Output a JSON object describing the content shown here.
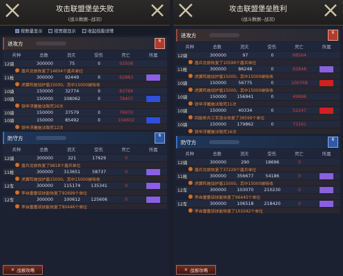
{
  "left": {
    "title": "攻击联盟堡垒失败",
    "subtitle": "(战斗数据--战况)",
    "options": [
      {
        "label": "按数量显示",
        "checked": true
      },
      {
        "label": "按贡献显示",
        "checked": false
      },
      {
        "label": "收起技能详情",
        "checked": false
      }
    ],
    "attack": {
      "label": "进攻方",
      "badge": "后防\n6",
      "color": "#b33a2f"
    },
    "defense": {
      "label": "防守方",
      "badge": "后防\n6",
      "color": "#2f58a6"
    },
    "headers": [
      "兵种",
      "总数",
      "消灭",
      "受伤",
      "死亡",
      "所属"
    ],
    "attack_rows": [
      {
        "unit": "12骑",
        "total": "300000",
        "kill": "75",
        "hurt": "0",
        "dead": "93508",
        "note": "盾兵龙旅恢复了14604个盾兵单位",
        "nk": ""
      },
      {
        "unit": "11枪",
        "total": "300000",
        "kill": "92449",
        "hurt": "0",
        "dead": "62883",
        "note": "虎翼阵施加护盾15000。其中15000被吸收",
        "nk": ""
      },
      {
        "unit": "10骑",
        "total": "150000",
        "kill": "32774",
        "hurt": "0",
        "dead": "83784",
        "note": "",
        "nk": ""
      },
      {
        "unit": "10骑",
        "total": "150000",
        "kill": "108062",
        "hurt": "0",
        "dead": "78407",
        "note": "铁甲浮屠施法致死16次",
        "nk": ""
      },
      {
        "unit": "10骑",
        "total": "150000",
        "kill": "37579",
        "hurt": "0",
        "dead": "76970",
        "note": "",
        "nk": ""
      },
      {
        "unit": "10骑",
        "total": "150000",
        "kill": "85492",
        "hurt": "0",
        "dead": "104602",
        "note": "铁甲浮屠施法致死12次",
        "nk": ""
      }
    ],
    "defense_rows": [
      {
        "unit": "12骑",
        "total": "300000",
        "kill": "321",
        "hurt": "17929",
        "dead": "0",
        "note": "盾兵龙旅恢复了9818个盾兵单位"
      },
      {
        "unit": "11枪",
        "total": "300000",
        "kill": "313651",
        "hurt": "58737",
        "dead": "0",
        "note": "虎翼阵施加护盾15000。其中15000被吸收"
      },
      {
        "unit": "12车",
        "total": "300000",
        "kill": "115174",
        "hurt": "135341",
        "dead": "0",
        "note": "李自雷雷该技能恢复了92699个单位"
      },
      {
        "unit": "12车",
        "total": "300000",
        "kill": "100612",
        "hurt": "125606",
        "dead": "0",
        "note": "李自雷雷该技能恢复了80446个单位"
      }
    ],
    "footer": "战报攻略"
  },
  "right": {
    "title": "攻击联盟堡垒胜利",
    "subtitle": "(战斗数据--战况)",
    "attack": {
      "label": "进攻方",
      "badge": "后防\n6"
    },
    "defense": {
      "label": "防守方",
      "badge": "后防\n6"
    },
    "headers": [
      "兵种",
      "总数",
      "消灭",
      "受伤",
      "死亡",
      "所属"
    ],
    "attack_rows": [
      {
        "unit": "12骑",
        "total": "300000",
        "kill": "97",
        "hurt": "0",
        "dead": "68564",
        "note": "盾兵龙旅恢复了10599个盾兵单位"
      },
      {
        "unit": "11枪",
        "total": "300000",
        "kill": "86248",
        "hurt": "0",
        "dead": "92848",
        "note": "虎翼阵施加护盾15000。其中15000被吸收"
      },
      {
        "unit": "10骑",
        "total": "150000",
        "kill": "56775",
        "hurt": "0",
        "dead": "100768",
        "note": "虎翼阵施加护盾15000。其中15000被吸收"
      },
      {
        "unit": "10骑",
        "total": "150000",
        "kill": "156941",
        "hurt": "0",
        "dead": "49896",
        "note": "铁甲浮屠施法致死11次"
      },
      {
        "unit": "10骑",
        "total": "150000",
        "kill": "40334",
        "hurt": "0",
        "dead": "52247",
        "note": "回旋枪兵三军混合恢复了38599个单位"
      },
      {
        "unit": "10骑",
        "total": "150000",
        "kill": "179862",
        "hurt": "0",
        "dead": "73161",
        "note": "铁甲浮屠施法致死16次"
      }
    ],
    "defense_rows": [
      {
        "unit": "12骑",
        "total": "300000",
        "kill": "290",
        "hurt": "18696",
        "dead": "0",
        "note": "盾兵龙旅恢复了37229个盾兵单位"
      },
      {
        "unit": "11枪",
        "total": "300000",
        "kill": "356677",
        "hurt": "54186",
        "dead": "0",
        "note": "虎翼阵施加护盾15000。其中15000被吸收"
      },
      {
        "unit": "12车",
        "total": "300000",
        "kill": "103070",
        "hurt": "210230",
        "dead": "0",
        "note": "李自雷雷该技能恢复了96445个单位"
      },
      {
        "unit": "12车",
        "total": "300000",
        "kill": "106518",
        "hurt": "218420",
        "dead": "0",
        "note": "李自雷雷该技能恢复了101042个单位"
      }
    ],
    "footer": "战报攻略"
  }
}
